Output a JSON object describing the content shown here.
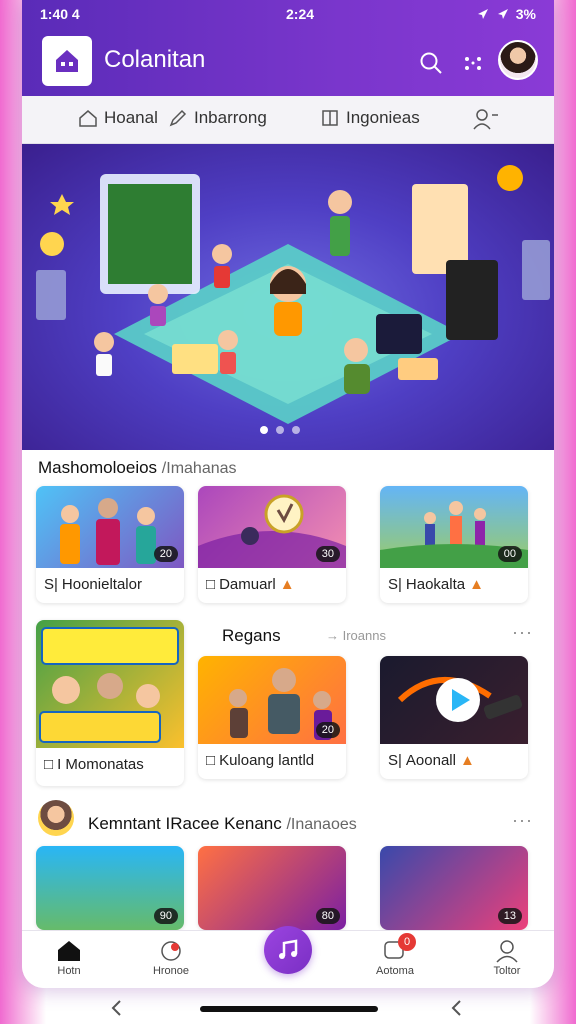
{
  "status": {
    "time": "1:40 4",
    "clock": "2:24",
    "battery": "3%"
  },
  "app": {
    "title": "Colanitan"
  },
  "tabs": [
    {
      "label": "Hoanal",
      "icon": "home-outline-icon"
    },
    {
      "label": "Inbarrong",
      "icon": "pen-icon"
    },
    {
      "label": "Ingonieas",
      "icon": "book-icon"
    },
    {
      "label": "",
      "icon": "add-user-icon"
    }
  ],
  "hero": {
    "icon": "classroom-illustration"
  },
  "section1": {
    "title": "Mashomoloeios",
    "sub": "/Imahanas"
  },
  "row1": [
    {
      "label": "Hoonieltalor",
      "prefix": "S|",
      "badge": "20",
      "thumb": [
        "#4fc3f7",
        "#7e57c2"
      ]
    },
    {
      "label": "Damuarl",
      "prefix": "□",
      "badge": "30",
      "thumb": [
        "#ab47bc",
        "#f48fb1"
      ]
    },
    {
      "label": "Haokalta",
      "prefix": "S|",
      "badge": "00",
      "thumb": [
        "#64b5f6",
        "#9ccc65"
      ]
    }
  ],
  "section2": {
    "title": "Regans",
    "sub": "→ Iroanns"
  },
  "row2": [
    {
      "label": "I Momonatas",
      "prefix": "□",
      "badge": "",
      "thumb": [
        "#43a047",
        "#fbc02d"
      ],
      "tall": true
    },
    {
      "label": "Kuloang lantld",
      "prefix": "□",
      "badge": "20",
      "thumb": [
        "#ffb300",
        "#ff7043"
      ]
    },
    {
      "label": "Aoonall",
      "prefix": "S|",
      "badge": "",
      "thumb": [
        "#1a1a2e",
        "#ff6d00"
      ],
      "play": true
    }
  ],
  "section3": {
    "title": "Kemntant IRacee Kenanc",
    "sub": "/Inanaoes"
  },
  "row3": [
    {
      "label": "",
      "prefix": "",
      "badge": "90",
      "thumb": [
        "#29b6f6",
        "#66bb6a"
      ]
    },
    {
      "label": "",
      "prefix": "",
      "badge": "80",
      "thumb": [
        "#ff7043",
        "#7b1fa2"
      ]
    },
    {
      "label": "",
      "prefix": "",
      "badge": "13",
      "thumb": [
        "#3949ab",
        "#ec407a"
      ]
    }
  ],
  "bottomnav": [
    {
      "label": "Hotn",
      "icon": "home-icon"
    },
    {
      "label": "Hronoe",
      "icon": "bell-icon"
    },
    {
      "label": "Aotoma",
      "icon": "chat-icon",
      "badge": "0"
    },
    {
      "label": "Toltor",
      "icon": "profile-icon"
    }
  ],
  "colors": {
    "accent": "#7a36cc",
    "topbar": "#5a2bb8"
  }
}
